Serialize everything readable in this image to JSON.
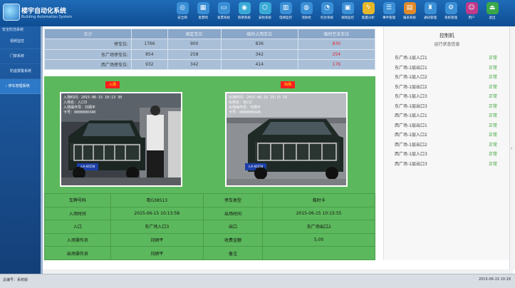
{
  "app": {
    "title": "楼宇自动化系统",
    "subtitle": "Building Automation System"
  },
  "toolbar": [
    {
      "label": "安全网",
      "icon": "globe-icon",
      "color": "#3a8fd6"
    },
    {
      "label": "发票网",
      "icon": "keyboard-icon",
      "color": "#3a8fd6"
    },
    {
      "label": "发票系统",
      "icon": "card-icon",
      "color": "#3a8fd6"
    },
    {
      "label": "照明系统",
      "icon": "bulb-icon",
      "color": "#3aa9d6"
    },
    {
      "label": "安防系统",
      "icon": "shield-icon",
      "color": "#3aa9d6"
    },
    {
      "label": "电梯监控",
      "icon": "elevator-icon",
      "color": "#3a8fd6"
    },
    {
      "label": "消防栓",
      "icon": "hydrant-icon",
      "color": "#3a8fd6"
    },
    {
      "label": "综合系统",
      "icon": "gauge-icon",
      "color": "#3a8fd6"
    },
    {
      "label": "视频监控",
      "icon": "monitor-icon",
      "color": "#3a8fd6"
    },
    {
      "label": "能量分析",
      "icon": "energy-icon",
      "color": "#e5b729"
    },
    {
      "label": "事件管理",
      "icon": "list-icon",
      "color": "#3a8fd6"
    },
    {
      "label": "报表系统",
      "icon": "report-icon",
      "color": "#e08a2b"
    },
    {
      "label": "通知管理",
      "icon": "notify-icon",
      "color": "#3a8fd6"
    },
    {
      "label": "系统管理",
      "icon": "gear-icon",
      "color": "#3a8fd6"
    },
    {
      "label": "用户",
      "icon": "user-icon",
      "color": "#c03a8a"
    },
    {
      "label": "退出",
      "icon": "exit-icon",
      "color": "#3aa84a"
    }
  ],
  "sidebar": {
    "header": "安全防范系统",
    "items": [
      {
        "label": "视频监控"
      },
      {
        "label": "门禁系统"
      },
      {
        "label": "防盗报警系统"
      },
      {
        "label": "停车管理系统",
        "active": true
      }
    ]
  },
  "stats": {
    "headers": [
      "合计",
      "固定车位",
      "临时占用车位",
      "临时空余车位"
    ],
    "rows": [
      {
        "label": "停车位:",
        "total": "1766",
        "fixed": "900",
        "temp": "836",
        "free": "830"
      },
      {
        "label": "东广场停车位:",
        "total": "854",
        "fixed": "258",
        "temp": "342",
        "free": "254"
      },
      {
        "label": "西广场停车位:",
        "total": "932",
        "fixed": "342",
        "temp": "414",
        "free": "176"
      }
    ]
  },
  "entry_cam": {
    "label": "入场",
    "overlay": [
      "入场时间：2015-06-15 10:13 30",
      "入场名：入口3",
      "入场操作员：刘炳平",
      "卡号：0000000340"
    ],
    "plate": "川A·66558"
  },
  "exit_cam": {
    "label": "出场",
    "overlay": [
      "出场时间：2015-06-15 10:15 55",
      "出场名：出口2",
      "出场操作员：刘炳平",
      "卡号：0000000345"
    ],
    "plate": "川A·66558"
  },
  "record": {
    "plate_label": "车牌号码",
    "plate_value": "粤G38513",
    "type_label": "停车类型",
    "type_value": "临时卡",
    "in_time_label": "入场时间",
    "in_time_value": "2015-06-15 10:13:58",
    "out_time_label": "出场时间",
    "out_time_value": "2015-06-15 10:15:55",
    "entrance_label": "入口",
    "entrance_value": "东广场入口3",
    "exit_label": "出口",
    "exit_value": "东广场出口2",
    "in_op_label": "入场操作员",
    "in_op_value": "刘炳平",
    "fee_label": "收费金额",
    "fee_value": "5.00",
    "out_op_label": "出场操作员",
    "out_op_value": "刘炳平",
    "note_label": "备注",
    "note_value": ""
  },
  "control": {
    "title": "控制机",
    "subtitle": "运行状态信息",
    "gates": [
      {
        "name": "东广场-1层入口1",
        "status": "正常"
      },
      {
        "name": "东广场-1层出口1",
        "status": "正常"
      },
      {
        "name": "东广场-1层入口2",
        "status": "正常"
      },
      {
        "name": "东广场-1层出口2",
        "status": "正常"
      },
      {
        "name": "东广场-1层入口3",
        "status": "正常"
      },
      {
        "name": "东广场-1层出口3",
        "status": "正常"
      },
      {
        "name": "西广场-1层入口1",
        "status": "正常"
      },
      {
        "name": "西广场-1层出口1",
        "status": "正常"
      },
      {
        "name": "西广场-1层入口2",
        "status": "正常"
      },
      {
        "name": "西广场-1层出口2",
        "status": "正常"
      },
      {
        "name": "西广场-1层入口3",
        "status": "正常"
      },
      {
        "name": "西广场-1层出口3",
        "status": "正常"
      }
    ]
  },
  "status": {
    "left": "总编号：系统版",
    "right": "2015-06-15 10:18"
  }
}
